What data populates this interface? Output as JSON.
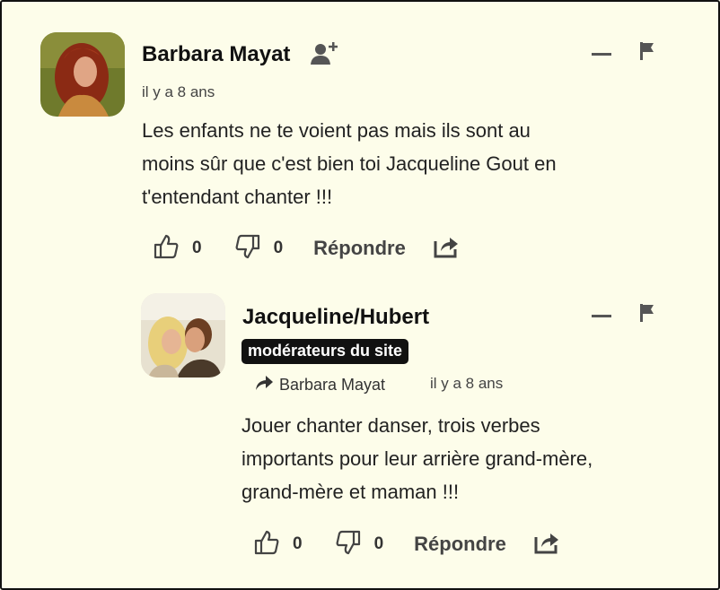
{
  "comments": [
    {
      "author": "Barbara Mayat",
      "time": "il y a 8 ans",
      "text_lines": [
        "Les enfants ne te voient pas mais ils sont au",
        "moins sûr que c'est bien toi Jacqueline Gout en",
        "t'entendant chanter !!!"
      ],
      "likes": "0",
      "dislikes": "0",
      "reply_label": "Répondre"
    }
  ],
  "reply": {
    "author": "Jacqueline/Hubert",
    "badge": "modérateurs du site",
    "reply_to": "Barbara Mayat",
    "time": "il y a 8 ans",
    "text_lines": [
      "Jouer chanter danser, trois verbes",
      "importants pour leur arrière grand-mère,",
      "grand-mère et maman !!!"
    ],
    "likes": "0",
    "dislikes": "0",
    "reply_label": "Répondre"
  },
  "icons": {
    "add_user": "add-user-icon",
    "minimize": "minimize-icon",
    "flag": "flag-icon",
    "like": "thumbs-up-icon",
    "dislike": "thumbs-down-icon",
    "share": "share-icon",
    "reply_arrow": "reply-arrow-icon"
  },
  "colors": {
    "background": "#fdfdea",
    "badge_bg": "#111111"
  }
}
